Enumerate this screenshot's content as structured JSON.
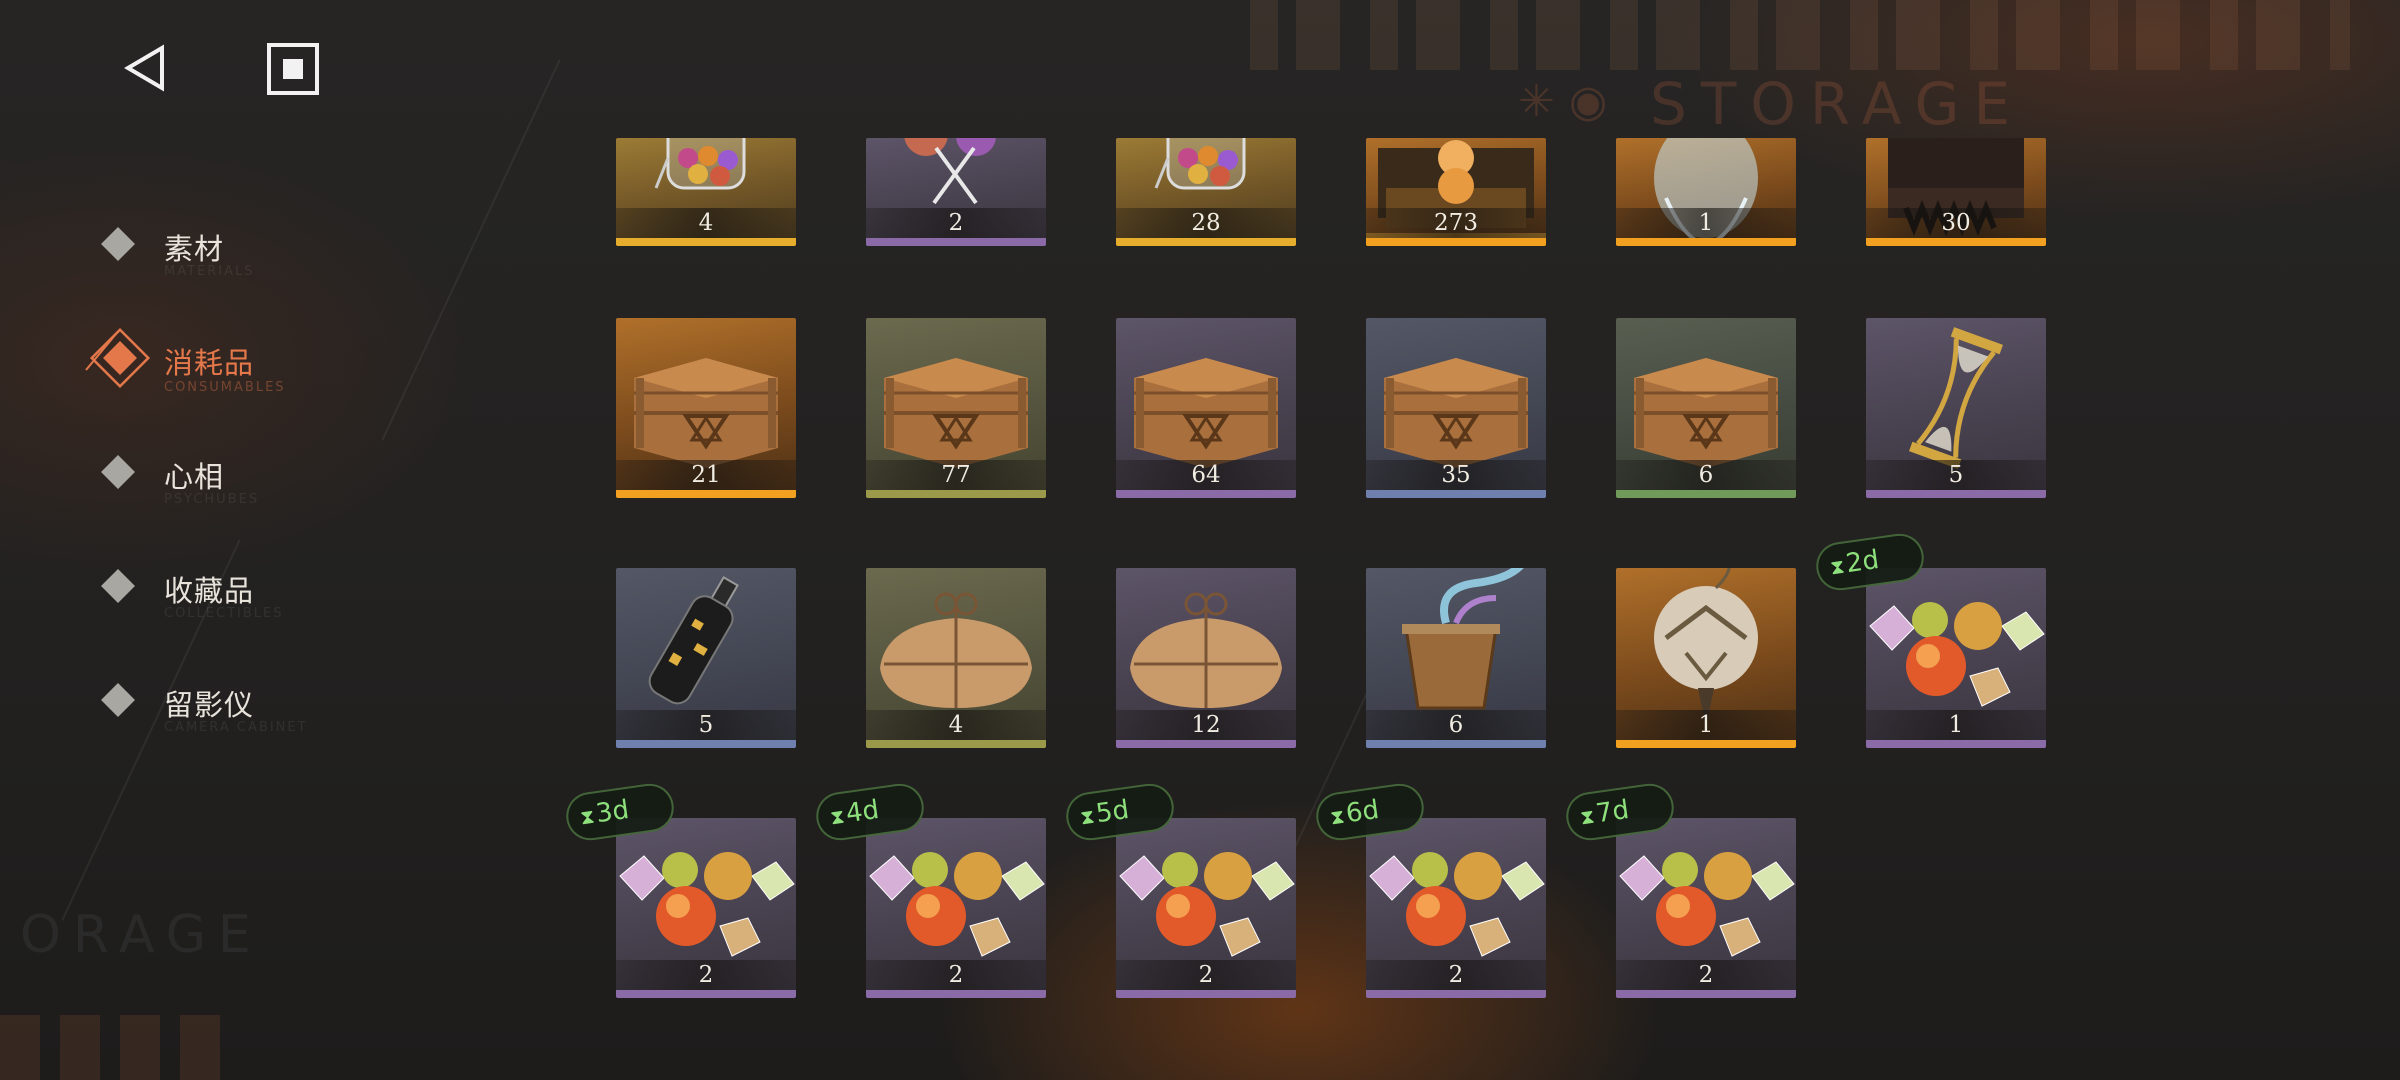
{
  "nav": {
    "back_icon": "back-triangle-icon",
    "stop_icon": "stop-square-icon"
  },
  "watermarks": {
    "top_right": "STORAGE",
    "bottom_left": "ORAGE"
  },
  "sidebar": {
    "items": [
      {
        "label": "素材",
        "sub": "MATERIALS",
        "active": false
      },
      {
        "label": "消耗品",
        "sub": "CONSUMABLES",
        "active": true
      },
      {
        "label": "心相",
        "sub": "PSYCHUBES",
        "active": false
      },
      {
        "label": "收藏品",
        "sub": "COLLECTIBLES",
        "active": false
      },
      {
        "label": "留影仪",
        "sub": "CAMERA CABINET",
        "active": false
      }
    ]
  },
  "colors": {
    "active_accent": "#e4784a",
    "timer_text": "#8ee07c",
    "rarity_gold": "#e6ae2c",
    "rarity_orange": "#f2a01f",
    "rarity_purple": "#8a6aa7",
    "rarity_blue": "#6f7fae",
    "rarity_green": "#6f9a5a"
  },
  "items": [
    {
      "count": "4",
      "rarity": "gold",
      "icon": "candy-jar-icon",
      "timer": ""
    },
    {
      "count": "2",
      "rarity": "purple",
      "icon": "lollipop-icon",
      "timer": ""
    },
    {
      "count": "28",
      "rarity": "gold",
      "icon": "candy-jar-icon",
      "timer": ""
    },
    {
      "count": "273",
      "rarity": "orange",
      "icon": "treasure-chest-icon",
      "timer": ""
    },
    {
      "count": "1",
      "rarity": "orange",
      "icon": "crystal-orb-icon",
      "timer": ""
    },
    {
      "count": "30",
      "rarity": "orange",
      "icon": "dark-chest-icon",
      "timer": ""
    },
    {
      "count": "21",
      "rarity": "orange",
      "icon": "wooden-crate-icon",
      "timer": ""
    },
    {
      "count": "77",
      "rarity": "olive",
      "icon": "wooden-crate-icon",
      "timer": ""
    },
    {
      "count": "64",
      "rarity": "purple",
      "icon": "wooden-crate-icon",
      "timer": ""
    },
    {
      "count": "35",
      "rarity": "blue",
      "icon": "wooden-crate-icon",
      "timer": ""
    },
    {
      "count": "6",
      "rarity": "green",
      "icon": "wooden-crate-icon",
      "timer": ""
    },
    {
      "count": "5",
      "rarity": "purple",
      "icon": "hourglass-icon",
      "timer": ""
    },
    {
      "count": "5",
      "rarity": "blue",
      "icon": "message-bottle-icon",
      "timer": ""
    },
    {
      "count": "4",
      "rarity": "olive",
      "icon": "paper-package-icon",
      "timer": ""
    },
    {
      "count": "12",
      "rarity": "purple",
      "icon": "paper-package-icon",
      "timer": ""
    },
    {
      "count": "6",
      "rarity": "blue",
      "icon": "magic-bucket-icon",
      "timer": ""
    },
    {
      "count": "1",
      "rarity": "orange",
      "icon": "bell-ornament-icon",
      "timer": ""
    },
    {
      "count": "1",
      "rarity": "purple",
      "icon": "fruit-candy-icon",
      "timer": "2d"
    },
    {
      "count": "2",
      "rarity": "purple",
      "icon": "fruit-candy-icon",
      "timer": "3d"
    },
    {
      "count": "2",
      "rarity": "purple",
      "icon": "fruit-candy-icon",
      "timer": "4d"
    },
    {
      "count": "2",
      "rarity": "purple",
      "icon": "fruit-candy-icon",
      "timer": "5d"
    },
    {
      "count": "2",
      "rarity": "purple",
      "icon": "fruit-candy-icon",
      "timer": "6d"
    },
    {
      "count": "2",
      "rarity": "purple",
      "icon": "fruit-candy-icon",
      "timer": "7d"
    }
  ]
}
